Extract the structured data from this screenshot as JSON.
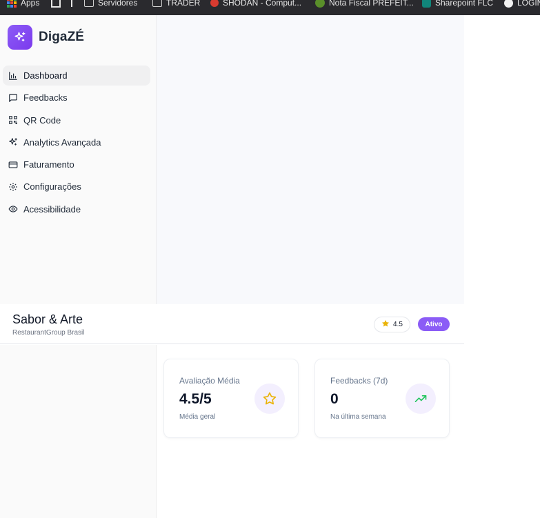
{
  "bookmarks": {
    "apps": "Apps",
    "items": [
      "Servidores",
      "TRADER",
      "SHODAN - Comput...",
      "Nota Fiscal PREFEIT...",
      "Sharepoint FLC",
      "LOGIN"
    ]
  },
  "brand": {
    "name": "DigaZÉ",
    "accent": "#8b5cf6"
  },
  "sidebar": {
    "items": [
      {
        "label": "Dashboard",
        "icon": "bar-chart-icon",
        "active": true
      },
      {
        "label": "Feedbacks",
        "icon": "message-square-icon"
      },
      {
        "label": "QR Code",
        "icon": "qr-code-icon"
      },
      {
        "label": "Analytics Avançada",
        "icon": "sparkles-icon"
      },
      {
        "label": "Faturamento",
        "icon": "credit-card-icon"
      },
      {
        "label": "Configurações",
        "icon": "gear-icon"
      },
      {
        "label": "Acessibilidade",
        "icon": "eye-icon"
      }
    ]
  },
  "header": {
    "restaurant_name": "Sabor & Arte",
    "group": "RestaurantGroup Brasil",
    "rating": "4.5",
    "status": "Ativo"
  },
  "cards": [
    {
      "label": "Avaliação Média",
      "value": "4.5/5",
      "sub": "Média geral",
      "icon": "star-icon",
      "icon_color": "#eab308"
    },
    {
      "label": "Feedbacks (7d)",
      "value": "0",
      "sub": "Na última semana",
      "icon": "trending-up-icon",
      "icon_color": "#22c55e"
    }
  ]
}
